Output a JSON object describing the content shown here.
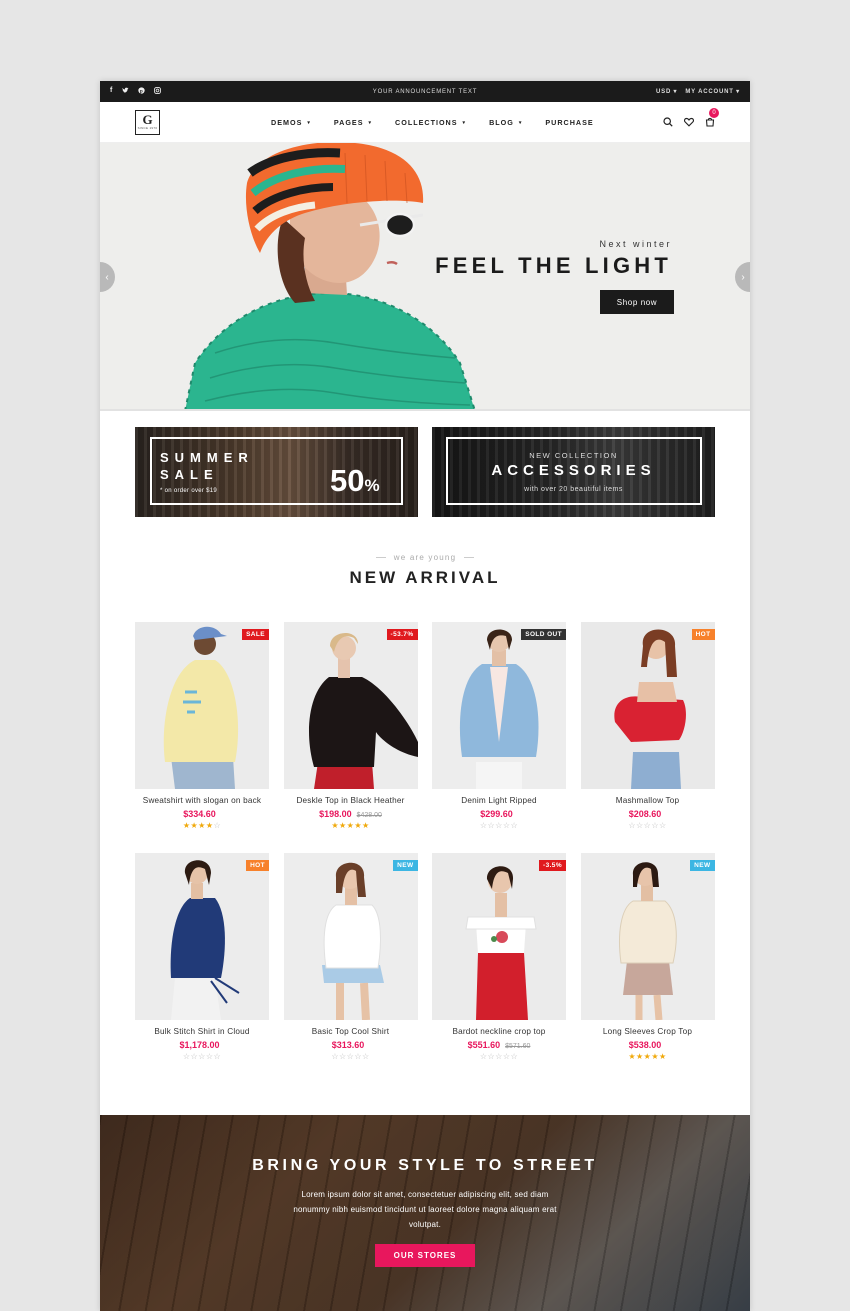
{
  "topbar": {
    "social_icons": [
      "facebook-icon",
      "twitter-icon",
      "pinterest-icon",
      "instagram-icon"
    ],
    "announcement": "YOUR ANNOUNCEMENT TEXT",
    "currency": "USD ▾",
    "account": "MY ACCOUNT ▾"
  },
  "header": {
    "logo_letter": "G",
    "logo_tagline": "SINCE 1970",
    "nav": [
      {
        "label": "DEMOS",
        "caret": "▾"
      },
      {
        "label": "PAGES",
        "caret": "▾"
      },
      {
        "label": "COLLECTIONS",
        "caret": "▾"
      },
      {
        "label": "BLOG",
        "caret": "▾"
      },
      {
        "label": "PURCHASE",
        "caret": ""
      }
    ],
    "cart_count": "0"
  },
  "hero": {
    "subtitle": "Next winter",
    "title": "FEEL THE LIGHT",
    "button": "Shop now",
    "prev": "‹",
    "next": "›"
  },
  "banners": {
    "summer": {
      "line1": "SUMMER",
      "line2": "SALE",
      "note": "* on order over $19",
      "percent": "50",
      "percent_sign": "%"
    },
    "accessories": {
      "sub": "NEW COLLECTION",
      "title": "ACCESSORIES",
      "note": "with over 20 beautiful items"
    }
  },
  "arrivals": {
    "subtitle": "we are young",
    "title": "NEW ARRIVAL",
    "products": [
      {
        "name": "Sweatshirt with slogan on back",
        "price": "$334.60",
        "old_price": "",
        "badge": "SALE",
        "badge_color": "#e0191e",
        "rating": 4
      },
      {
        "name": "Deskle Top in Black Heather",
        "price": "$198.00",
        "old_price": "$428.00",
        "badge": "-53.7%",
        "badge_color": "#e0191e",
        "rating": 5
      },
      {
        "name": "Denim Light Ripped",
        "price": "$299.60",
        "old_price": "",
        "badge": "SOLD OUT",
        "badge_color": "#333333",
        "rating": 0
      },
      {
        "name": "Mashmallow Top",
        "price": "$208.60",
        "old_price": "",
        "badge": "HOT",
        "badge_color": "#f7812b",
        "rating": 0
      },
      {
        "name": "Bulk Stitch Shirt in Cloud",
        "price": "$1,178.00",
        "old_price": "",
        "badge": "HOT",
        "badge_color": "#f7812b",
        "rating": 0
      },
      {
        "name": "Basic Top Cool Shirt",
        "price": "$313.60",
        "old_price": "",
        "badge": "NEW",
        "badge_color": "#3cb6e3",
        "rating": 0
      },
      {
        "name": "Bardot neckline crop top",
        "price": "$551.60",
        "old_price": "$571.60",
        "badge": "-3.5%",
        "badge_color": "#e0191e",
        "rating": 0
      },
      {
        "name": "Long Sleeves Crop Top",
        "price": "$538.00",
        "old_price": "",
        "badge": "NEW",
        "badge_color": "#3cb6e3",
        "rating": 5
      }
    ]
  },
  "street": {
    "title": "BRING YOUR STYLE TO STREET",
    "text": "Lorem ipsum dolor sit amet, consectetuer adipiscing elit, sed diam nonummy nibh euismod tincidunt ut laoreet dolore magna aliquam erat volutpat.",
    "button": "OUR STORES"
  },
  "colors": {
    "accent": "#e8175d",
    "dark": "#1b1b1b",
    "star": "#f0a90b"
  }
}
